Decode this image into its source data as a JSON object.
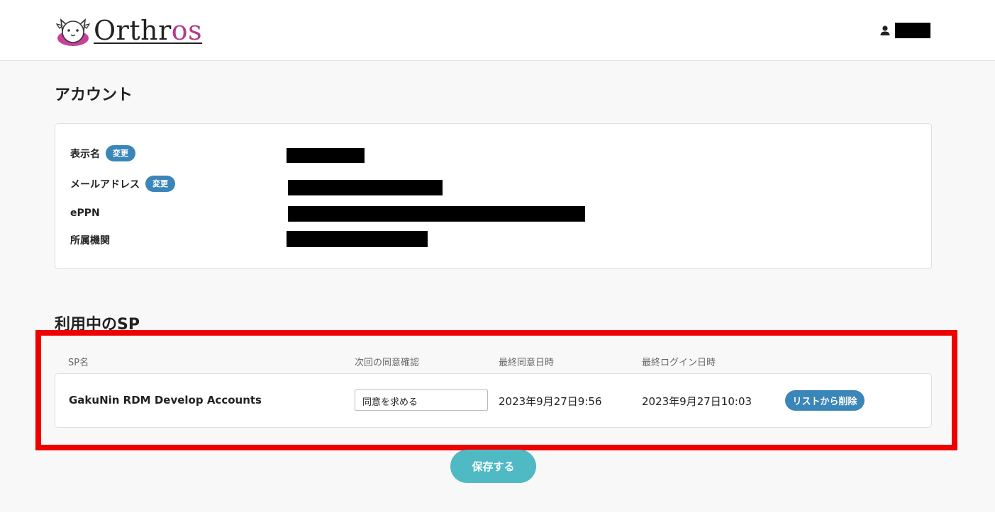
{
  "app": {
    "logo_text_main": "Orthr",
    "logo_text_accent": "os"
  },
  "account": {
    "title": "アカウント",
    "fields": [
      {
        "label": "表示名",
        "change_label": "変更"
      },
      {
        "label": "メールアドレス",
        "change_label": "変更"
      },
      {
        "label": "ePPN"
      },
      {
        "label": "所属機関"
      }
    ]
  },
  "sp": {
    "title": "利用中のSP",
    "columns": [
      "SP名",
      "次回の同意確認",
      "最終同意日時",
      "最終ログイン日時"
    ],
    "rows": [
      {
        "name": "GakuNin RDM Develop Accounts",
        "consent": "同意を求める",
        "last_consent": "2023年9月27日9:56",
        "last_login": "2023年9月27日10:03",
        "remove_label": "リストから削除"
      }
    ]
  },
  "save_label": "保存する",
  "colors": {
    "badge": "#3b86b8",
    "save": "#4fb9c4",
    "highlight_frame": "#ee0000",
    "logo_accent": "#b33a8c"
  }
}
